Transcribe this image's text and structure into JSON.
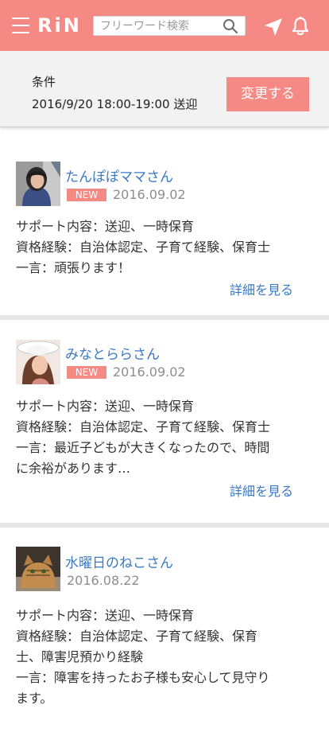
{
  "header": {
    "logo": "RiN",
    "search_placeholder": "フリーワード検索",
    "accent_color": "#f58a84"
  },
  "conditions": {
    "title": "条件",
    "value": "2016/9/20 18:00-19:00 送迎",
    "change_label": "変更する"
  },
  "supporters": [
    {
      "name": "たんぽぽママさん",
      "badge": "NEW",
      "date": "2016.09.02",
      "lines": [
        "サポート内容：送迎、一時保育",
        "資格経験：自治体認定、子育て経験、保育士",
        "一言：頑張ります！"
      ],
      "detail_label": "詳細を見る"
    },
    {
      "name": "みなとららさん",
      "badge": "NEW",
      "date": "2016.09.02",
      "lines": [
        "サポート内容：送迎、一時保育",
        "資格経験：自治体認定、子育て経験、保育士",
        "一言：最近子どもが大きくなったので、時間",
        "に余裕があります…"
      ],
      "detail_label": "詳細を見る"
    },
    {
      "name": "水曜日のねこさん",
      "date": "2016.08.22",
      "lines": [
        "サポート内容：送迎、一時保育",
        "資格経験：自治体認定、子育て経験、保育",
        "士、障害児預かり経験",
        "一言：障害を持ったお子様も安心して見守り",
        "ます。"
      ]
    }
  ]
}
